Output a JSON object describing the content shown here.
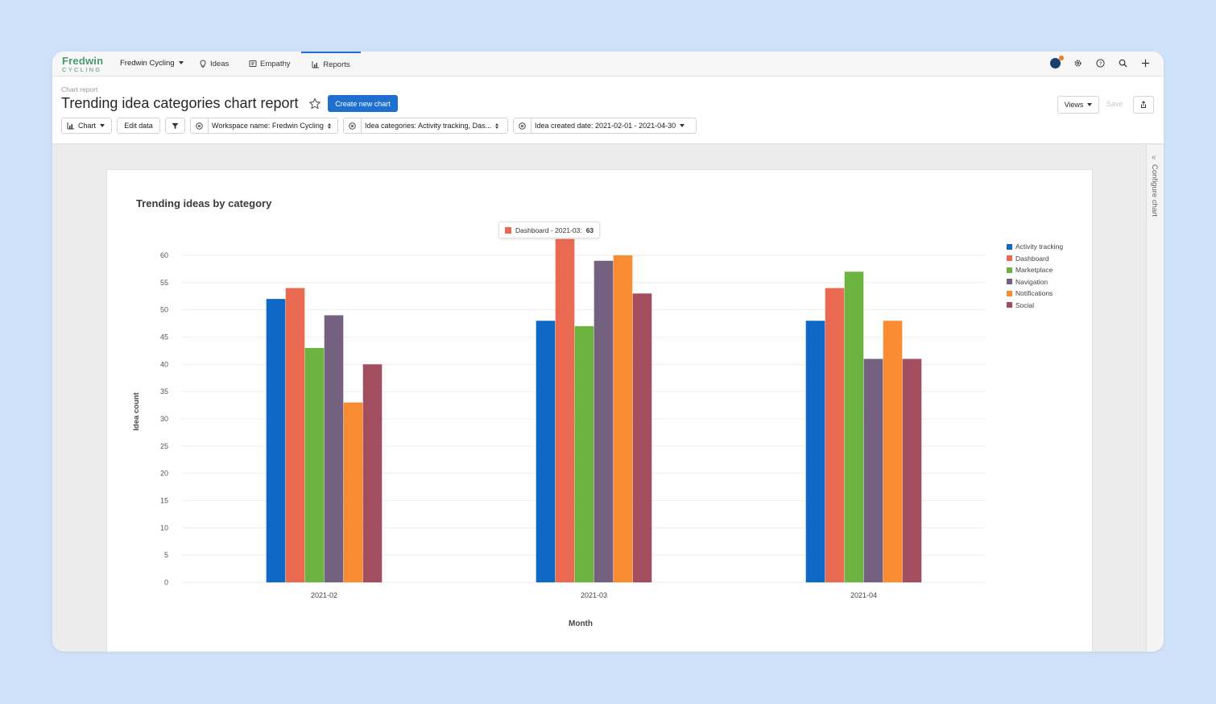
{
  "app": {
    "logo_top": "Fredwin",
    "logo_bottom": "CYCLING",
    "workspace": "Fredwin Cycling",
    "tabs": [
      {
        "label": "Ideas"
      },
      {
        "label": "Empathy"
      },
      {
        "label": "Reports"
      }
    ]
  },
  "header": {
    "breadcrumb": "Chart report",
    "title": "Trending idea categories chart report",
    "create_button": "Create new chart",
    "views_button": "Views",
    "save_button": "Save"
  },
  "filters": {
    "chart_button": "Chart",
    "edit_data_button": "Edit data",
    "workspace_filter": "Workspace name: Fredwin Cycling",
    "categories_filter": "Idea categories: Activity tracking, Das...",
    "date_filter": "Idea created date: 2021-02-01 - 2021-04-30"
  },
  "config_panel": {
    "label": "Configure chart"
  },
  "tooltip": {
    "label": "Dashboard - 2021-03:",
    "value": "63"
  },
  "colors": {
    "accent": "#1f6fd0",
    "activity_tracking": "#1068c6",
    "dashboard": "#ea6a51",
    "marketplace": "#6db33f",
    "navigation": "#74607f",
    "notifications": "#f98c30",
    "social": "#a24e5f"
  },
  "chart_data": {
    "type": "bar",
    "title": "Trending ideas by category",
    "xlabel": "Month",
    "ylabel": "Idea count",
    "categories": [
      "2021-02",
      "2021-03",
      "2021-04"
    ],
    "ylim": [
      0,
      60
    ],
    "yticks": [
      0,
      5,
      10,
      15,
      20,
      25,
      30,
      35,
      40,
      45,
      50,
      55,
      60
    ],
    "grid": true,
    "legend_position": "right",
    "series": [
      {
        "name": "Activity tracking",
        "color": "#1068c6",
        "values": [
          52,
          48,
          48
        ]
      },
      {
        "name": "Dashboard",
        "color": "#ea6a51",
        "values": [
          54,
          63,
          54
        ]
      },
      {
        "name": "Marketplace",
        "color": "#6db33f",
        "values": [
          43,
          47,
          57
        ]
      },
      {
        "name": "Navigation",
        "color": "#74607f",
        "values": [
          49,
          59,
          41
        ]
      },
      {
        "name": "Notifications",
        "color": "#f98c30",
        "values": [
          33,
          60,
          48
        ]
      },
      {
        "name": "Social",
        "color": "#a24e5f",
        "values": [
          40,
          53,
          41
        ]
      }
    ]
  }
}
